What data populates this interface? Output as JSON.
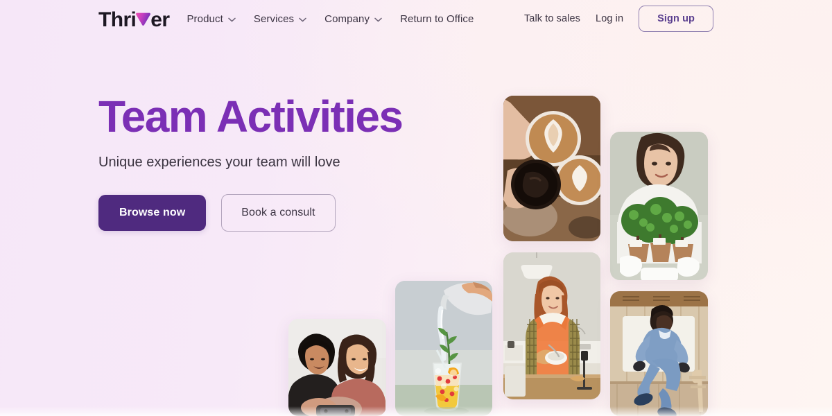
{
  "brand": {
    "name_before": "Thri",
    "name_after": "er",
    "logo_mark": "triangle-v-gradient",
    "logo_gradient_from": "#e84ab5",
    "logo_gradient_to": "#7b2fb5",
    "text_color": "#1d1823"
  },
  "colors": {
    "accent_purple": "#7b2fb5",
    "primary_button": "#4f2a7f",
    "link_purple": "#5b3f8f",
    "body_text": "#3b3342",
    "bg_left": "#f6e7f8",
    "bg_right": "#fdf3f1"
  },
  "nav": {
    "items": [
      {
        "label": "Product",
        "has_dropdown": true,
        "icon": "chevron-down-icon"
      },
      {
        "label": "Services",
        "has_dropdown": true,
        "icon": "chevron-down-icon"
      },
      {
        "label": "Company",
        "has_dropdown": true,
        "icon": "chevron-down-icon"
      },
      {
        "label": "Return to Office",
        "has_dropdown": false,
        "icon": ""
      }
    ],
    "talk_to_sales": "Talk to sales",
    "log_in": "Log in",
    "sign_up": "Sign up"
  },
  "hero": {
    "title": "Team Activities",
    "subtitle": "Unique experiences your team will love",
    "primary_cta": "Browse now",
    "secondary_cta": "Book a consult"
  },
  "collage": {
    "images": [
      {
        "id": "coffee-cups",
        "alt": "Three hands toasting with latte art coffee cups"
      },
      {
        "id": "plant-workshop",
        "alt": "Smiling woman holding potted bonsai plants"
      },
      {
        "id": "cooking-class",
        "alt": "Woman in plaid shirt cooking and filming in a kitchen"
      },
      {
        "id": "gaming-duo",
        "alt": "Man and woman laughing while playing a mobile game"
      },
      {
        "id": "mocktail-pour",
        "alt": "Water being poured into a fruit mocktail glass"
      },
      {
        "id": "dance-class",
        "alt": "Man in denim outfit dancing in a studio"
      }
    ]
  }
}
